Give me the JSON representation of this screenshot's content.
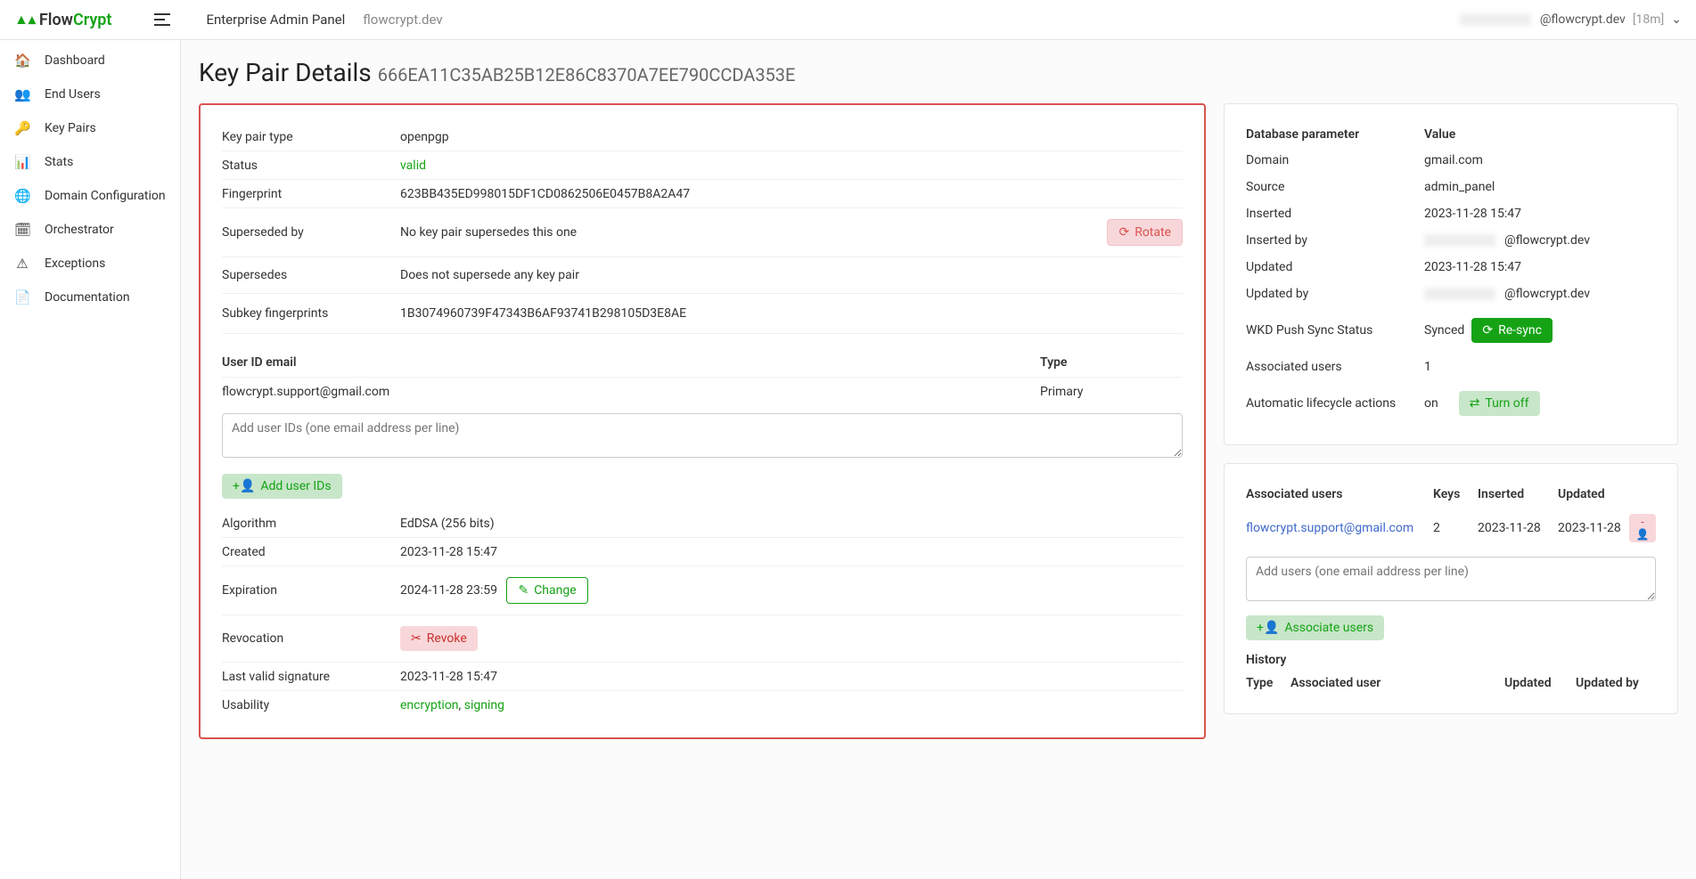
{
  "header": {
    "brand_flow": "Flow",
    "brand_crypt": "Crypt",
    "title": "Enterprise Admin Panel",
    "domain": "flowcrypt.dev",
    "user_suffix": "@flowcrypt.dev",
    "session": "[18m]"
  },
  "sidebar": {
    "items": [
      {
        "icon": "🏠",
        "label": "Dashboard"
      },
      {
        "icon": "👥",
        "label": "End Users"
      },
      {
        "icon": "🔑",
        "label": "Key Pairs"
      },
      {
        "icon": "📊",
        "label": "Stats"
      },
      {
        "icon": "🌐",
        "label": "Domain Configuration"
      },
      {
        "icon": "🗓",
        "label": "Orchestrator"
      },
      {
        "icon": "⚠",
        "label": "Exceptions"
      },
      {
        "icon": "📄",
        "label": "Documentation"
      }
    ]
  },
  "page": {
    "title": "Key Pair Details",
    "key_id": "666EA11C35AB25B12E86C8370A7EE790CCDA353E"
  },
  "details": {
    "key_pair_type": {
      "label": "Key pair type",
      "value": "openpgp"
    },
    "status": {
      "label": "Status",
      "value": "valid"
    },
    "fingerprint": {
      "label": "Fingerprint",
      "value": "623BB435ED998015DF1CD0862506E0457B8A2A47"
    },
    "superseded_by": {
      "label": "Superseded by",
      "value": "No key pair supersedes this one",
      "button": "Rotate"
    },
    "supersedes": {
      "label": "Supersedes",
      "value": "Does not supersede any key pair"
    },
    "subkey_fingerprints": {
      "label": "Subkey fingerprints",
      "value": "1B3074960739F47343B6AF93741B298105D3E8AE"
    },
    "uid": {
      "header_email": "User ID email",
      "header_type": "Type",
      "rows": [
        {
          "email": "flowcrypt.support@gmail.com",
          "type": "Primary"
        }
      ],
      "placeholder": "Add user IDs (one email address per line)",
      "add_button": "Add user IDs"
    },
    "algorithm": {
      "label": "Algorithm",
      "value": "EdDSA (256 bits)"
    },
    "created": {
      "label": "Created",
      "value": "2023-11-28 15:47"
    },
    "expiration": {
      "label": "Expiration",
      "value": "2024-11-28 23:59",
      "button": "Change"
    },
    "revocation": {
      "label": "Revocation",
      "button": "Revoke"
    },
    "last_valid_signature": {
      "label": "Last valid signature",
      "value": "2023-11-28 15:47"
    },
    "usability": {
      "label": "Usability",
      "value1": "encryption",
      "sep": ", ",
      "value2": "signing"
    }
  },
  "db": {
    "header_param": "Database parameter",
    "header_value": "Value",
    "rows": {
      "domain": {
        "label": "Domain",
        "value": "gmail.com"
      },
      "source": {
        "label": "Source",
        "value": "admin_panel"
      },
      "inserted": {
        "label": "Inserted",
        "value": "2023-11-28 15:47"
      },
      "inserted_by": {
        "label": "Inserted by",
        "suffix": "@flowcrypt.dev"
      },
      "updated": {
        "label": "Updated",
        "value": "2023-11-28 15:47"
      },
      "updated_by": {
        "label": "Updated by",
        "suffix": "@flowcrypt.dev"
      },
      "wkd": {
        "label": "WKD Push Sync Status",
        "value": "Synced",
        "button": "Re-sync"
      },
      "assoc_users": {
        "label": "Associated users",
        "value": "1"
      },
      "auto_lifecycle": {
        "label": "Automatic lifecycle actions",
        "value": "on",
        "button": "Turn off"
      }
    }
  },
  "associated": {
    "title": "Associated users",
    "header_keys": "Keys",
    "header_inserted": "Inserted",
    "header_updated": "Updated",
    "rows": [
      {
        "user": "flowcrypt.support@gmail.com",
        "keys": "2",
        "inserted": "2023-11-28",
        "updated": "2023-11-28"
      }
    ],
    "placeholder": "Add users (one email address per line)",
    "button": "Associate users"
  },
  "history": {
    "title": "History",
    "header_type": "Type",
    "header_user": "Associated user",
    "header_updated": "Updated",
    "header_by": "Updated by"
  }
}
